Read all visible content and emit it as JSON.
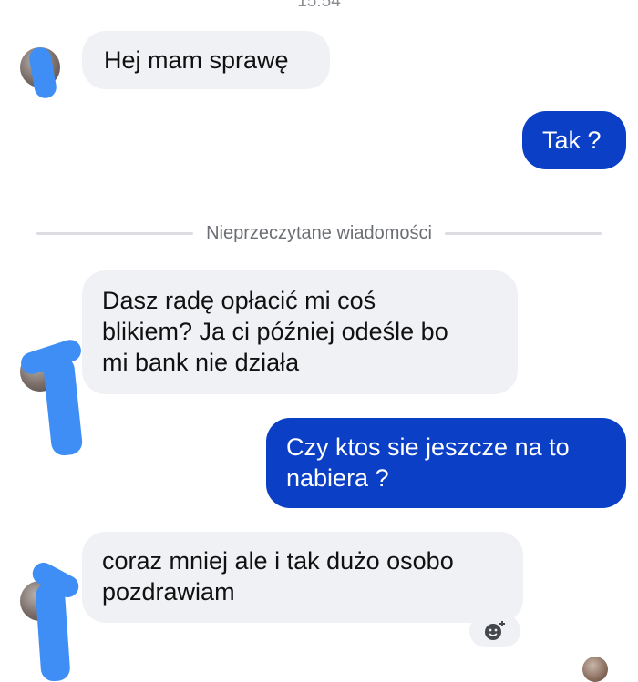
{
  "header": {
    "timestamp": "15:54"
  },
  "messages": [
    {
      "direction": "incoming",
      "text": "Hej mam sprawę"
    },
    {
      "direction": "outgoing",
      "text": "Tak ?"
    },
    {
      "direction": "incoming",
      "lines": [
        "Dasz radę opłacić mi coś",
        "blikiem? Ja ci później odeśle bo",
        "mi bank nie działa"
      ]
    },
    {
      "direction": "outgoing",
      "lines": [
        "Czy ktos sie jeszcze na to",
        "nabiera ?"
      ]
    },
    {
      "direction": "incoming",
      "lines": [
        "coraz mniej ale i tak dużo osobo",
        "pozdrawiam"
      ]
    }
  ],
  "divider": {
    "label": "Nieprzeczytane wiadomości"
  },
  "reaction_button": {
    "icon": "add-reaction-icon"
  },
  "colors": {
    "outgoing_bubble": "#0a3fc6",
    "incoming_bubble": "#f0f1f4",
    "redaction": "#3e8ef5"
  }
}
